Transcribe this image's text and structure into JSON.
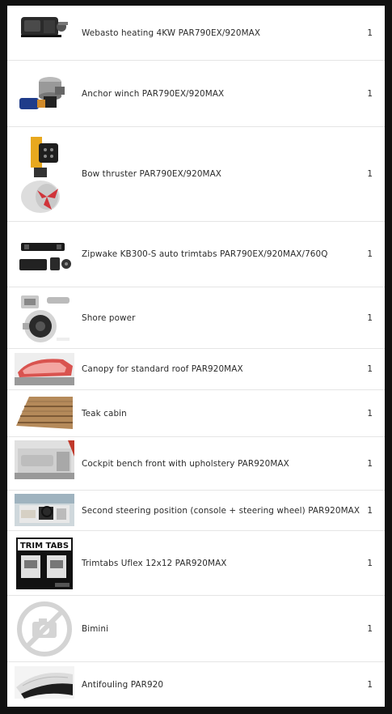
{
  "items": [
    {
      "name": "Webasto heating 4KW PAR790EX/920MAX",
      "qty": "1",
      "image": "webasto-heater-image"
    },
    {
      "name": "Anchor winch PAR790EX/920MAX",
      "qty": "1",
      "image": "anchor-winch-image"
    },
    {
      "name": "Bow thruster PAR790EX/920MAX",
      "qty": "1",
      "image": "bow-thruster-image"
    },
    {
      "name": "Zipwake KB300-S auto trimtabs PAR790EX/920MAX/760Q",
      "qty": "1",
      "image": "zipwake-trimtabs-image"
    },
    {
      "name": "Shore power",
      "qty": "1",
      "image": "shore-power-image"
    },
    {
      "name": "Canopy for standard roof PAR920MAX",
      "qty": "1",
      "image": "canopy-image"
    },
    {
      "name": "Teak cabin",
      "qty": "1",
      "image": "teak-deck-image"
    },
    {
      "name": "Cockpit bench front with upholstery PAR920MAX",
      "qty": "1",
      "image": "cockpit-bench-image"
    },
    {
      "name": "Second steering position (console + steering wheel) PAR920MAX",
      "qty": "1",
      "image": "steering-position-image"
    },
    {
      "name": "Trimtabs Uflex 12x12 PAR920MAX",
      "qty": "1",
      "image": "trimtabs-box-image",
      "image_text": "TRIM TABS"
    },
    {
      "name": "Bimini",
      "qty": "1",
      "image": "no-image-placeholder-icon"
    },
    {
      "name": "Antifouling PAR920",
      "qty": "1",
      "image": "antifouling-hull-image"
    }
  ]
}
